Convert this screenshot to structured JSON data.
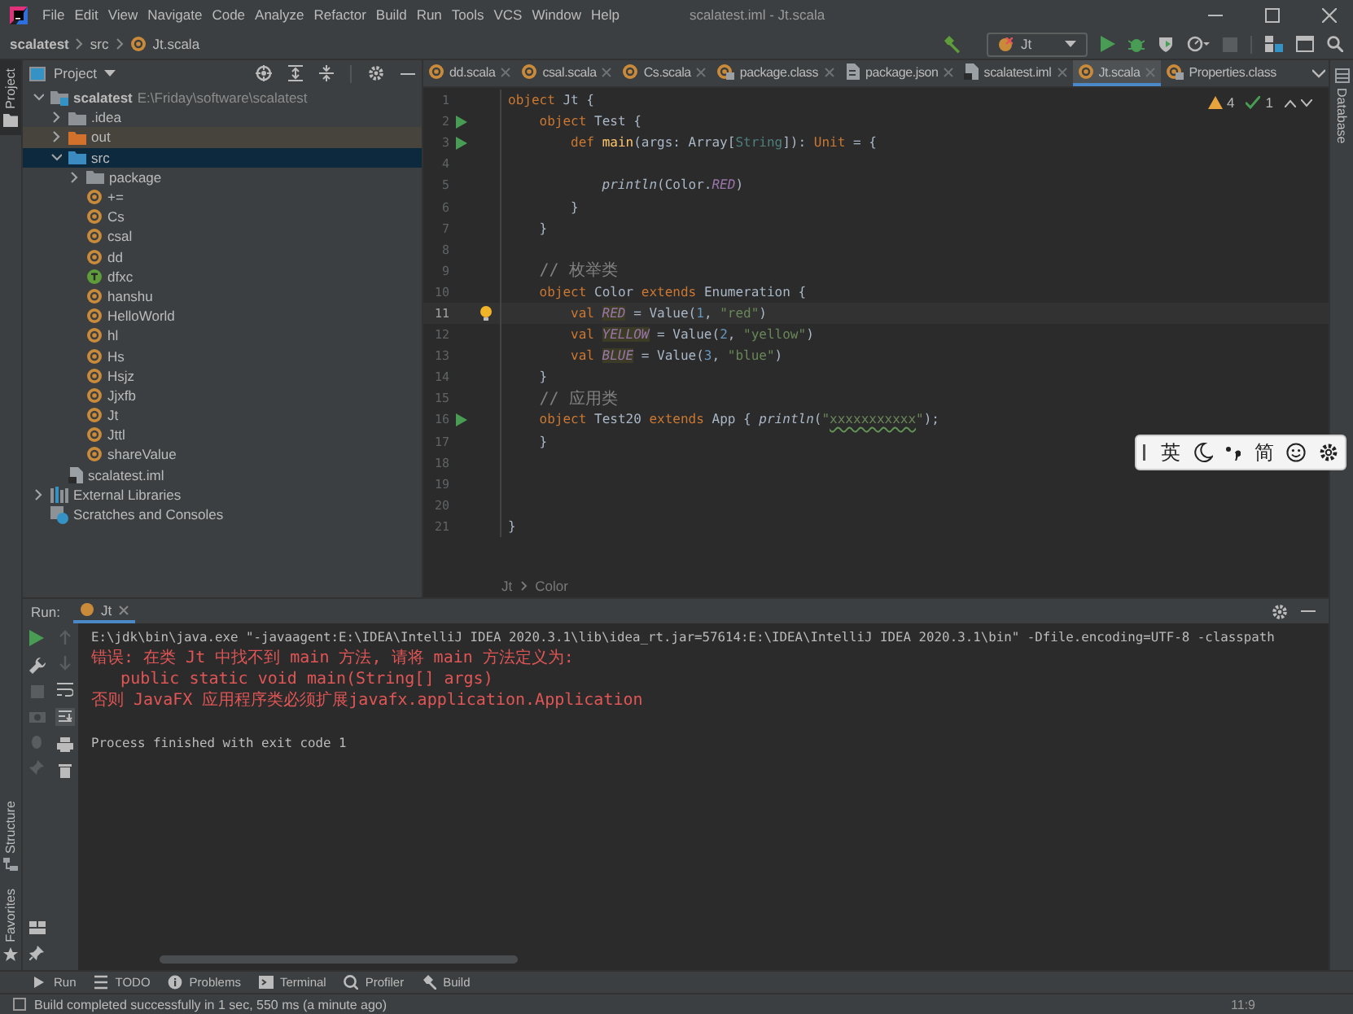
{
  "window": {
    "title": "scalatest.iml - Jt.scala"
  },
  "menu": [
    "File",
    "Edit",
    "View",
    "Navigate",
    "Code",
    "Analyze",
    "Refactor",
    "Build",
    "Run",
    "Tools",
    "VCS",
    "Window",
    "Help"
  ],
  "breadcrumb": [
    "scalatest",
    "src",
    "Jt.scala"
  ],
  "run_config": {
    "label": "Jt"
  },
  "left_stripe_top": [
    {
      "label": "Project",
      "selected": true
    }
  ],
  "left_stripe_bottom": [
    {
      "label": "Structure",
      "selected": false
    },
    {
      "label": "Favorites",
      "selected": false
    }
  ],
  "right_stripe": [
    {
      "label": "Database",
      "selected": false
    }
  ],
  "project": {
    "title": "Project",
    "tree": [
      {
        "label": "scalatest",
        "path": "E:\\Friday\\software\\scalatest",
        "kind": "module",
        "expanded": true,
        "selected": false,
        "children": [
          {
            "label": ".idea",
            "kind": "folder",
            "expanded": false,
            "selected": false
          },
          {
            "label": "out",
            "kind": "excluded",
            "expanded": false,
            "selected": false
          },
          {
            "label": "src",
            "kind": "source",
            "expanded": true,
            "selected": true,
            "children": [
              {
                "label": "package",
                "kind": "folder",
                "expanded": false,
                "selected": false
              },
              {
                "label": "+=",
                "kind": "object",
                "selected": false
              },
              {
                "label": "Cs",
                "kind": "object",
                "selected": false
              },
              {
                "label": "csal",
                "kind": "object",
                "selected": false
              },
              {
                "label": "dd",
                "kind": "object",
                "selected": false
              },
              {
                "label": "dfxc",
                "kind": "trait",
                "selected": false
              },
              {
                "label": "hanshu",
                "kind": "object",
                "selected": false
              },
              {
                "label": "HelloWorld",
                "kind": "object",
                "selected": false
              },
              {
                "label": "hl",
                "kind": "object",
                "selected": false
              },
              {
                "label": "Hs",
                "kind": "object",
                "selected": false
              },
              {
                "label": "Hsjz",
                "kind": "object",
                "selected": false
              },
              {
                "label": "Jjxfb",
                "kind": "object",
                "selected": false
              },
              {
                "label": "Jt",
                "kind": "object",
                "selected": false
              },
              {
                "label": "Jttl",
                "kind": "object",
                "selected": false
              },
              {
                "label": "shareValue",
                "kind": "object",
                "selected": false
              }
            ]
          },
          {
            "label": "scalatest.iml",
            "kind": "file",
            "selected": false
          }
        ]
      },
      {
        "label": "External Libraries",
        "kind": "libraries",
        "expanded": false,
        "selected": false
      },
      {
        "label": "Scratches and Consoles",
        "kind": "scratches",
        "selected": false
      }
    ]
  },
  "editor_tabs": [
    {
      "label": "dd.scala",
      "kind": "object",
      "selected": false,
      "closable": true
    },
    {
      "label": "csal.scala",
      "kind": "object",
      "selected": false,
      "closable": true
    },
    {
      "label": "Cs.scala",
      "kind": "object",
      "selected": false,
      "closable": true
    },
    {
      "label": "package.class",
      "kind": "classfile",
      "selected": false,
      "closable": true
    },
    {
      "label": "package.json",
      "kind": "json",
      "selected": false,
      "closable": true
    },
    {
      "label": "scalatest.iml",
      "kind": "file",
      "selected": false,
      "closable": true
    },
    {
      "label": "Jt.scala",
      "kind": "object",
      "selected": true,
      "closable": true
    },
    {
      "label": "Properties.class",
      "kind": "classfile",
      "selected": false,
      "closable": false
    }
  ],
  "inspections": {
    "warnings": "4",
    "passed": "1"
  },
  "code": [
    {
      "number": "1",
      "run": false,
      "bulb": false,
      "current": false,
      "tokens": [
        {
          "kind": "keyword",
          "text": "object"
        },
        {
          "kind": "plain",
          "text": " Jt {"
        }
      ]
    },
    {
      "number": "2",
      "run": true,
      "bulb": false,
      "current": false,
      "tokens": [
        {
          "kind": "keyword",
          "text": "    object"
        },
        {
          "kind": "plain",
          "text": " Test {"
        }
      ]
    },
    {
      "number": "3",
      "run": true,
      "bulb": false,
      "current": false,
      "tokens": [
        {
          "kind": "keyword",
          "text": "        def"
        },
        {
          "kind": "decl",
          "text": " main"
        },
        {
          "kind": "plain",
          "text": "(args: Array["
        },
        {
          "kind": "type",
          "text": "String"
        },
        {
          "kind": "plain",
          "text": "]): "
        },
        {
          "kind": "keyword",
          "text": "Unit"
        },
        {
          "kind": "plain",
          "text": " = {"
        }
      ]
    },
    {
      "number": "4",
      "run": false,
      "bulb": false,
      "current": false
    },
    {
      "number": "5",
      "run": false,
      "bulb": false,
      "current": false,
      "tokens": [
        {
          "kind": "call",
          "text": "            println"
        },
        {
          "kind": "plain",
          "text": "(Color."
        },
        {
          "kind": "field",
          "text": "RED"
        },
        {
          "kind": "plain",
          "text": ")"
        }
      ]
    },
    {
      "number": "6",
      "run": false,
      "bulb": false,
      "current": false,
      "tokens": [
        {
          "kind": "plain",
          "text": "        }"
        }
      ]
    },
    {
      "number": "7",
      "run": false,
      "bulb": false,
      "current": false,
      "tokens": [
        {
          "kind": "plain",
          "text": "    }"
        }
      ]
    },
    {
      "number": "8",
      "run": false,
      "bulb": false,
      "current": false
    },
    {
      "number": "9",
      "run": false,
      "bulb": false,
      "current": false,
      "tokens": [
        {
          "kind": "comment",
          "text": "    // 枚举类"
        }
      ]
    },
    {
      "number": "10",
      "run": false,
      "bulb": false,
      "current": false,
      "tokens": [
        {
          "kind": "keyword",
          "text": "    object"
        },
        {
          "kind": "plain",
          "text": " Color "
        },
        {
          "kind": "keyword",
          "text": "extends"
        },
        {
          "kind": "plain",
          "text": " Enumeration {"
        }
      ]
    },
    {
      "number": "11",
      "run": false,
      "bulb": true,
      "current": true,
      "tokens": [
        {
          "kind": "keyword",
          "text": "        val "
        },
        {
          "kind": "warnfield",
          "text": "RED"
        },
        {
          "kind": "plain",
          "text": " = Value("
        },
        {
          "kind": "number",
          "text": "1"
        },
        {
          "kind": "plain",
          "text": ", "
        },
        {
          "kind": "string",
          "text": "\"red\""
        },
        {
          "kind": "plain",
          "text": ")"
        }
      ]
    },
    {
      "number": "12",
      "run": false,
      "bulb": false,
      "current": false,
      "tokens": [
        {
          "kind": "keyword",
          "text": "        val "
        },
        {
          "kind": "warnfield",
          "text": "YELLOW"
        },
        {
          "kind": "plain",
          "text": " = Value("
        },
        {
          "kind": "number",
          "text": "2"
        },
        {
          "kind": "plain",
          "text": ", "
        },
        {
          "kind": "string",
          "text": "\"yellow\""
        },
        {
          "kind": "plain",
          "text": ")"
        }
      ]
    },
    {
      "number": "13",
      "run": false,
      "bulb": false,
      "current": false,
      "tokens": [
        {
          "kind": "keyword",
          "text": "        val "
        },
        {
          "kind": "warnfield",
          "text": "BLUE"
        },
        {
          "kind": "plain",
          "text": " = Value("
        },
        {
          "kind": "number",
          "text": "3"
        },
        {
          "kind": "plain",
          "text": ", "
        },
        {
          "kind": "string",
          "text": "\"blue\""
        },
        {
          "kind": "plain",
          "text": ")"
        }
      ]
    },
    {
      "number": "14",
      "run": false,
      "bulb": false,
      "current": false,
      "tokens": [
        {
          "kind": "plain",
          "text": "    }"
        }
      ]
    },
    {
      "number": "15",
      "run": false,
      "bulb": false,
      "current": false,
      "tokens": [
        {
          "kind": "comment",
          "text": "    // 应用类"
        }
      ]
    },
    {
      "number": "16",
      "run": true,
      "bulb": false,
      "current": false,
      "tokens": [
        {
          "kind": "keyword",
          "text": "    object"
        },
        {
          "kind": "plain",
          "text": " Test20 "
        },
        {
          "kind": "keyword",
          "text": "extends"
        },
        {
          "kind": "plain",
          "text": " App { "
        },
        {
          "kind": "call",
          "text": "println"
        },
        {
          "kind": "plain",
          "text": "("
        },
        {
          "kind": "string",
          "text": "\""
        },
        {
          "kind": "typo",
          "text": "xxxxxxxxxxx"
        },
        {
          "kind": "string",
          "text": "\""
        },
        {
          "kind": "plain",
          "text": ");"
        }
      ]
    },
    {
      "number": "17",
      "run": false,
      "bulb": false,
      "current": false,
      "tokens": [
        {
          "kind": "plain",
          "text": "    }"
        }
      ]
    },
    {
      "number": "18",
      "run": false,
      "bulb": false,
      "current": false
    },
    {
      "number": "19",
      "run": false,
      "bulb": false,
      "current": false
    },
    {
      "number": "20",
      "run": false,
      "bulb": false,
      "current": false
    },
    {
      "number": "21",
      "run": false,
      "bulb": false,
      "current": false,
      "tokens": [
        {
          "kind": "plain",
          "text": "}"
        }
      ]
    }
  ],
  "editor_breadcrumb": [
    "Jt",
    "Color"
  ],
  "ime_toolbar": {
    "language": "英",
    "script": "简"
  },
  "run_panel": {
    "label": "Run:",
    "tab": "Jt",
    "output": [
      {
        "kind": "command",
        "text": "E:\\jdk\\bin\\java.exe \"-javaagent:E:\\IDEA\\IntelliJ IDEA 2020.3.1\\lib\\idea_rt.jar=57614:E:\\IDEA\\IntelliJ IDEA 2020.3.1\\bin\" -Dfile.encoding=UTF-8 -classpath"
      },
      {
        "kind": "error",
        "text": "错误: 在类 Jt 中找不到 main 方法, 请将 main 方法定义为:"
      },
      {
        "kind": "error",
        "text": "   public static void main(String[] args)"
      },
      {
        "kind": "error",
        "text": "否则 JavaFX 应用程序类必须扩展javafx.application.Application"
      },
      {
        "kind": "exit",
        "text": "Process finished with exit code 1"
      }
    ]
  },
  "tool_tabs": [
    {
      "label": "Run"
    },
    {
      "label": "TODO"
    },
    {
      "label": "Problems"
    },
    {
      "label": "Terminal"
    },
    {
      "label": "Profiler"
    },
    {
      "label": "Build"
    }
  ],
  "status_bar": {
    "message": "Build completed successfully in 1 sec, 550 ms (a minute ago)",
    "position": "11:9"
  }
}
